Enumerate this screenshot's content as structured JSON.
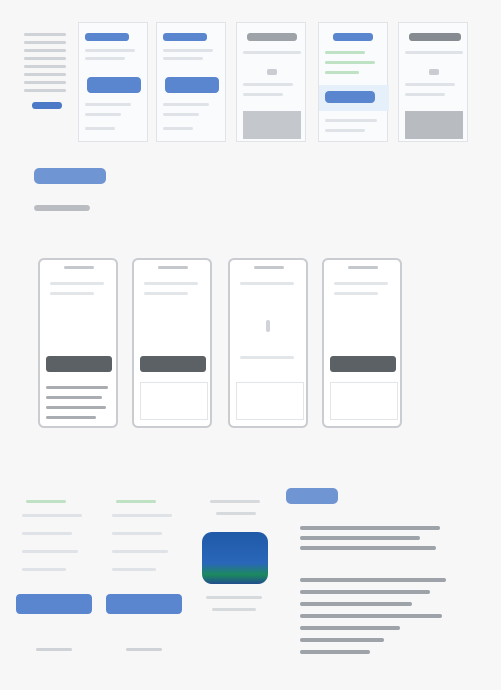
{
  "row1": {
    "sidebar": {
      "selected_label": ""
    },
    "thumbs": [
      {
        "button_label": ""
      },
      {
        "button_label": ""
      },
      {
        "button_label": ""
      },
      {
        "button_label": ""
      },
      {
        "button_label": ""
      }
    ]
  },
  "section1": {
    "label": "",
    "sublabel": ""
  },
  "phones": [
    {
      "button_label": ""
    },
    {
      "button_label": ""
    },
    {
      "button_label": ""
    },
    {
      "button_label": ""
    }
  ],
  "section2": {
    "label": ""
  },
  "forms": [
    {
      "button_label": ""
    },
    {
      "button_label": ""
    }
  ],
  "colors": {
    "accent": "#5a86cf",
    "accent_light": "#6f95d2",
    "dark_button": "#5c6166",
    "icon_top": "#1f5aa8",
    "icon_green": "#1c8a5e",
    "background": "#f7f7f8"
  }
}
